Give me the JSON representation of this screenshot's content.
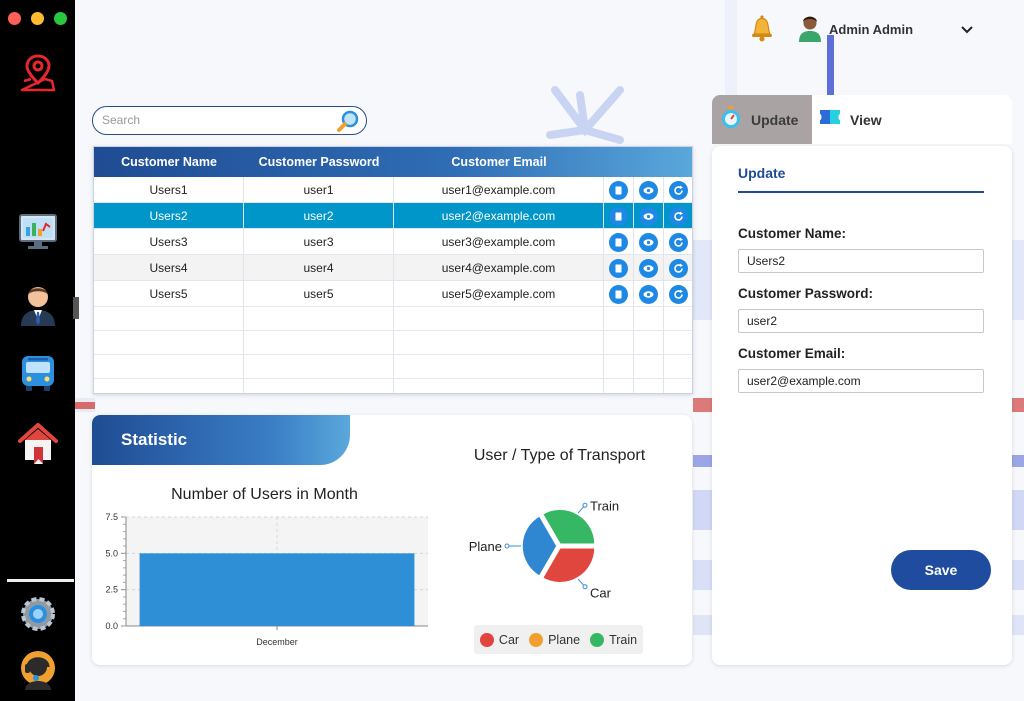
{
  "header": {
    "user_name": "Admin Admin"
  },
  "search": {
    "placeholder": "Search"
  },
  "table": {
    "columns": [
      "Customer Name",
      "Customer Password",
      "Customer Email"
    ],
    "rows": [
      {
        "name": "Users1",
        "password": "user1",
        "email": "user1@example.com"
      },
      {
        "name": "Users2",
        "password": "user2",
        "email": "user2@example.com"
      },
      {
        "name": "Users3",
        "password": "user3",
        "email": "user3@example.com"
      },
      {
        "name": "Users4",
        "password": "user4",
        "email": "user4@example.com"
      },
      {
        "name": "Users5",
        "password": "user5",
        "email": "user5@example.com"
      }
    ],
    "selected_index": 1
  },
  "statistic": {
    "title": "Statistic"
  },
  "chart_data": [
    {
      "type": "bar",
      "title": "Number of Users in Month",
      "categories": [
        "December"
      ],
      "values": [
        5
      ],
      "ylim": [
        0,
        7.5
      ],
      "yticks": [
        "0.0",
        "2.5",
        "5.0",
        "7.5"
      ],
      "color": "#2e8ed6",
      "grid": true
    },
    {
      "type": "pie",
      "title": "User / Type of Transport",
      "labels": [
        "Car",
        "Plane",
        "Train"
      ],
      "values": [
        1,
        1,
        1
      ],
      "colors": [
        "#e0463e",
        "#2f86d1",
        "#36b764"
      ],
      "legend": [
        {
          "label": "Car",
          "color": "#e0463e"
        },
        {
          "label": "Plane",
          "color": "#f0a030"
        },
        {
          "label": "Train",
          "color": "#36b764"
        }
      ],
      "legend_position": "bottom"
    }
  ],
  "panel": {
    "tab_update": "Update",
    "tab_view": "View",
    "form_title": "Update",
    "name_label": "Customer Name:",
    "name_value": "Users2",
    "password_label": "Customer Password:",
    "password_value": "user2",
    "email_label": "Customer Email:",
    "email_value": "user2@example.com",
    "save_label": "Save"
  },
  "colors": {
    "accent": "#1f4c93",
    "selected_row": "#0096c9",
    "action_icon": "#1e88e5",
    "sidebar": "#000000"
  },
  "icons": [
    "map-pin-icon",
    "dashboard-icon",
    "user-icon",
    "bus-icon",
    "home-icon",
    "settings-icon",
    "support-icon",
    "bell-icon",
    "search-icon",
    "delete-icon",
    "view-icon",
    "refresh-icon",
    "stopwatch-icon",
    "ticket-icon",
    "chevron-down-icon"
  ]
}
